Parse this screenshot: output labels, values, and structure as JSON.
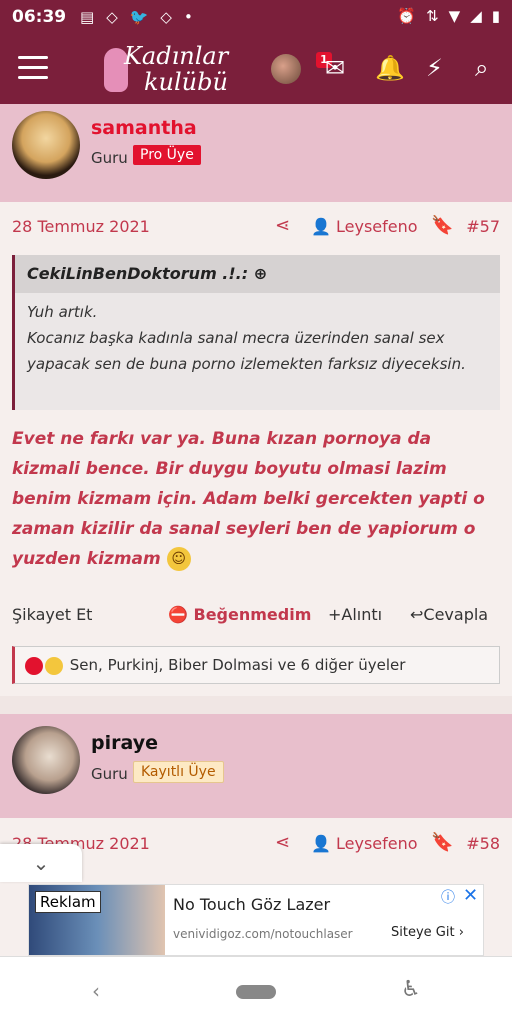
{
  "status": {
    "time": "06:39",
    "notifications": [
      "▤",
      "◇",
      "🐦",
      "◇",
      "•"
    ],
    "system": [
      "⏰",
      "⇅",
      "▼",
      "◢",
      "▮"
    ]
  },
  "app": {
    "logo_line1": "Kadınlar",
    "logo_line2": "kulübü",
    "message_count": "1"
  },
  "posts": [
    {
      "username": "samantha",
      "title": "Guru",
      "role": "Pro Üye",
      "date": "28 Temmuz 2021",
      "reacted_user": "Leysefeno",
      "number": "#57",
      "quote": {
        "author": "CekiLinBenDoktorum .!.:",
        "lines": [
          "Yuh artık.",
          "Kocanız başka kadınla sanal mecra üzerinden sanal sex yapacak sen de buna porno izlemekten farksız diyeceksin."
        ]
      },
      "message": "Evet ne farkı var ya. Buna kızan pornoya da kizmali bence. Bir duygu boyutu olmasi lazim benim kizmam için. Adam belki gercekten yapti o zaman kizilir da sanal seyleri ben de yapiorum o yuzden kizmam",
      "actions": {
        "report": "Şikayet Et",
        "dislike": "Beğenmedim",
        "quote": "Alıntı",
        "reply": "Cevapla"
      },
      "reactions": "Sen, Purkinj, Biber Dolmasi ve 6 diğer üyeler"
    },
    {
      "username": "piraye",
      "title": "Guru",
      "role": "Kayıtlı Üye",
      "date": "28 Temmuz 2021",
      "reacted_user": "Leysefeno",
      "number": "#58"
    }
  ],
  "ad": {
    "label": "Reklam",
    "title": "No Touch Göz Lazer",
    "url": "venividigoz.com/notouchlaser",
    "cta": "Siteye Git"
  },
  "colors": {
    "brand": "#7b1f3b",
    "accent": "#c2384d",
    "header_bg": "#e8bfcc"
  }
}
